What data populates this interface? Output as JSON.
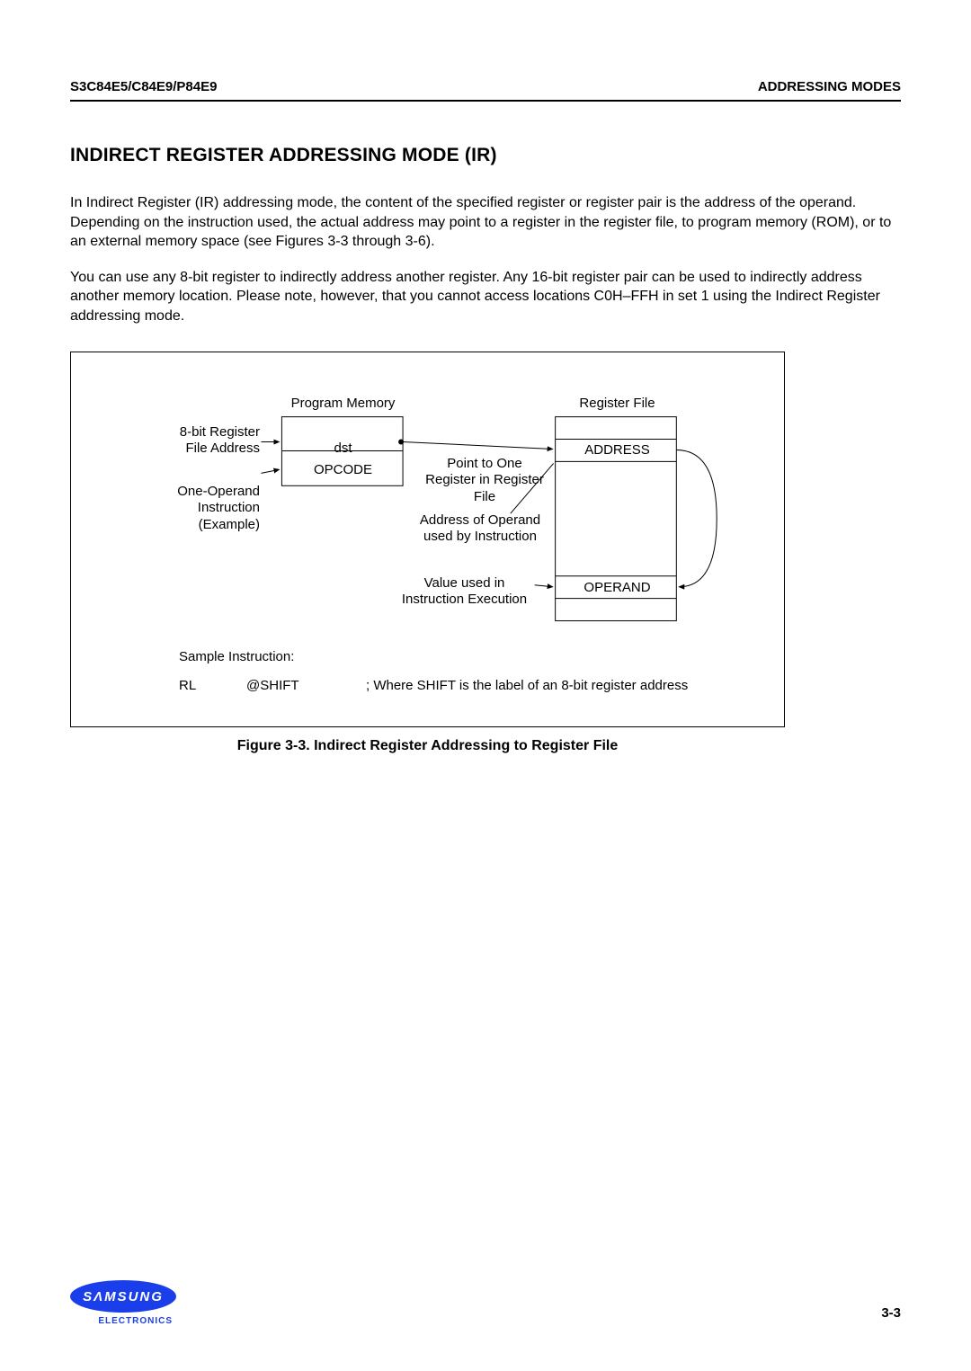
{
  "header": {
    "left": "S3C84E5/C84E9/P84E9",
    "right": "ADDRESSING MODES"
  },
  "title": "INDIRECT REGISTER ADDRESSING MODE (IR)",
  "para1": "In Indirect Register (IR) addressing mode, the content of the specified register or register pair is the address of the operand. Depending on the instruction used, the actual address may point to a register in the register file, to program memory (ROM), or to an external memory space (see Figures 3-3 through 3-6).",
  "para2": "You can use any 8-bit register to indirectly address another register. Any 16-bit register pair can be used to indirectly address another memory location. Please note, however, that you cannot access locations C0H–FFH in set 1 using the Indirect Register addressing mode.",
  "figure": {
    "program_memory": "Program Memory",
    "register_file": "Register File",
    "label_8bit": "8-bit Register\nFile Address",
    "label_oneoperand": "One-Operand\nInstruction\n(Example)",
    "dst": "dst",
    "opcode": "OPCODE",
    "point_to": "Point to One\nRegister in Register\nFile",
    "address": "ADDRESS",
    "addr_of_operand": "Address of Operand\nused by Instruction",
    "value_used": "Value used in\nInstruction Execution",
    "operand": "OPERAND",
    "sample_instruction": "Sample Instruction:",
    "sample_code_rl": "RL",
    "sample_code_shift": "@SHIFT",
    "sample_comment": ";    Where SHIFT is the label of an 8-bit register address"
  },
  "caption": "Figure 3-3. Indirect Register Addressing to Register File",
  "footer": {
    "logo_text": "SΛMSUNG",
    "logo_sub": "ELECTRONICS",
    "page_num": "3-3"
  }
}
